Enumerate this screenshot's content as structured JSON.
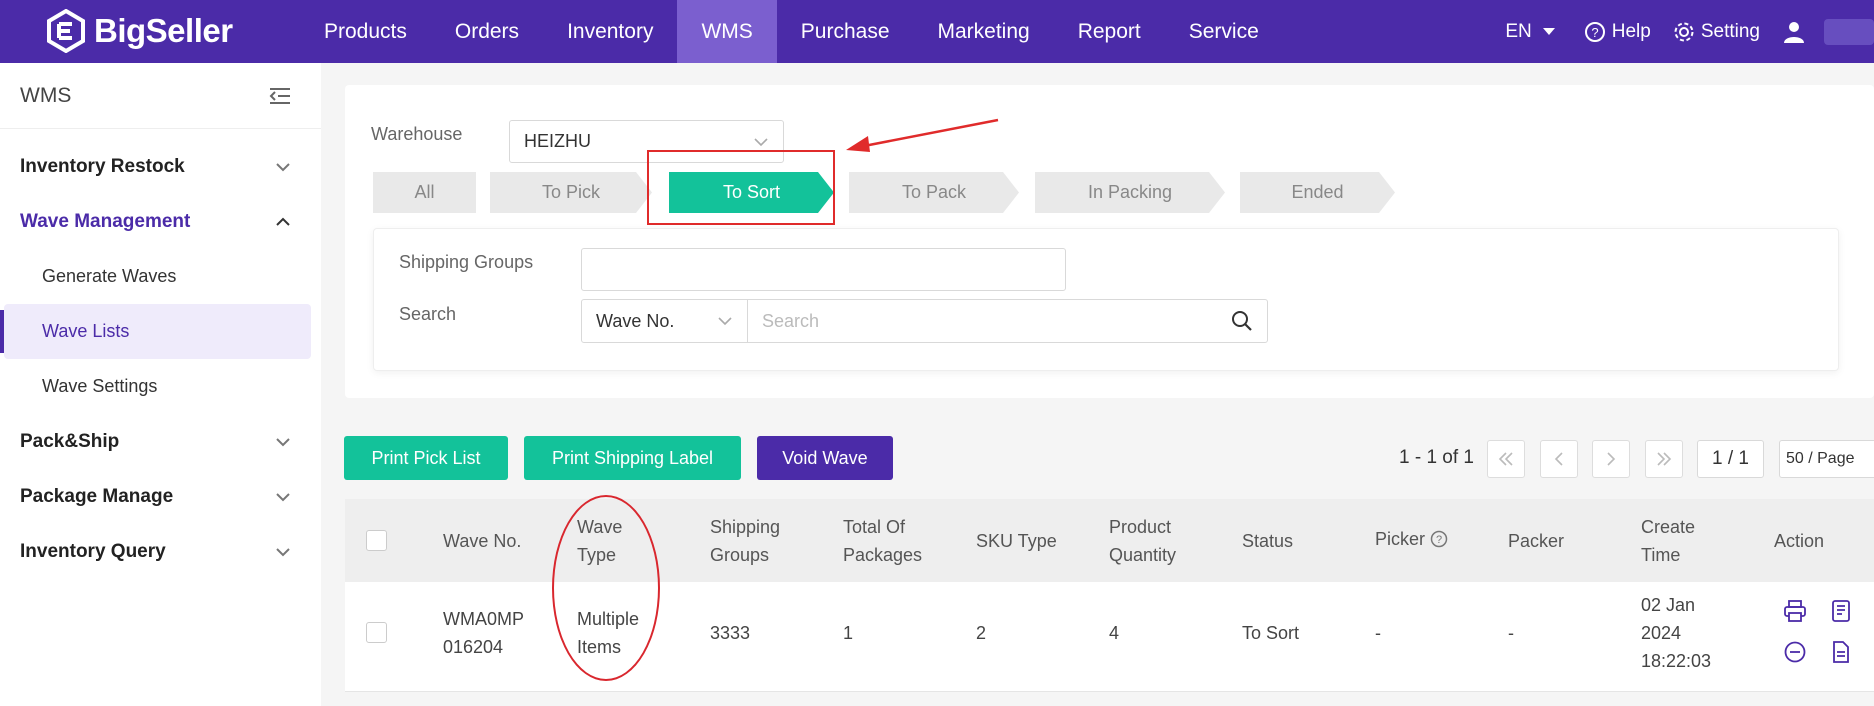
{
  "brand": "BigSeller",
  "nav": [
    "Products",
    "Orders",
    "Inventory",
    "WMS",
    "Purchase",
    "Marketing",
    "Report",
    "Service"
  ],
  "top_right": {
    "lang": "EN",
    "help": "Help",
    "setting": "Setting"
  },
  "sidebar": {
    "title": "WMS",
    "items": [
      {
        "label": "Inventory Restock"
      },
      {
        "label": "Wave Management"
      },
      {
        "label": "Generate Waves"
      },
      {
        "label": "Wave Lists"
      },
      {
        "label": "Wave Settings"
      },
      {
        "label": "Pack&Ship"
      },
      {
        "label": "Package Manage"
      },
      {
        "label": "Inventory Query"
      }
    ]
  },
  "filters": {
    "warehouse_label": "Warehouse",
    "warehouse_value": "HEIZHU",
    "steps": [
      "All",
      "To Pick",
      "To Sort",
      "To Pack",
      "In Packing",
      "Ended"
    ],
    "shipping_groups_label": "Shipping Groups",
    "search_label": "Search",
    "search_field": "Wave No.",
    "search_placeholder": "Search"
  },
  "toolbar": {
    "print_pick_list": "Print Pick List",
    "print_shipping_label": "Print Shipping Label",
    "void_wave": "Void Wave",
    "range": "1 - 1 of 1",
    "page": "1 / 1",
    "page_size": "50 / Page"
  },
  "table": {
    "headers": {
      "wave_no": "Wave No.",
      "wave_type_1": "Wave",
      "wave_type_2": "Type",
      "shipping_1": "Shipping",
      "shipping_2": "Groups",
      "total_1": "Total Of",
      "total_2": "Packages",
      "sku_type": "SKU Type",
      "product_1": "Product",
      "product_2": "Quantity",
      "status": "Status",
      "picker": "Picker",
      "packer": "Packer",
      "create_1": "Create",
      "create_2": "Time",
      "action": "Action"
    },
    "row": {
      "wave_no_1": "WMA0MP",
      "wave_no_2": "016204",
      "wave_type_1": "Multiple",
      "wave_type_2": "Items",
      "shipping_groups": "3333",
      "total_packages": "1",
      "sku_type": "2",
      "product_quantity": "4",
      "status": "To Sort",
      "picker": "-",
      "packer": "-",
      "create_1": "02 Jan",
      "create_2": "2024",
      "create_3": "18:22:03"
    }
  },
  "colors": {
    "primary": "#4b2ba8",
    "green": "#13c29a",
    "annotation": "#e02b2b"
  }
}
